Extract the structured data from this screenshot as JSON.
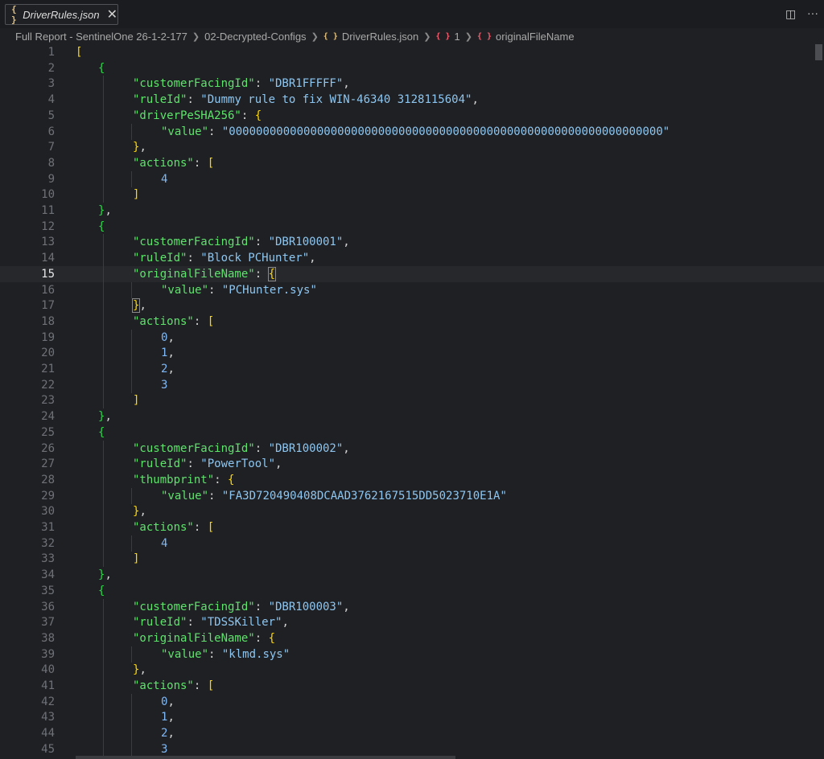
{
  "tab": {
    "icon": "{ }",
    "label": "DriverRules.json",
    "close": "✕"
  },
  "top_icons": {
    "split": "◫",
    "more": "···"
  },
  "breadcrumb": [
    {
      "label": "Full Report - SentinelOne 26-1-2-177"
    },
    {
      "label": "02-Decrypted-Configs"
    },
    {
      "icon": "{ }",
      "label": "DriverRules.json"
    },
    {
      "icon": "{ }",
      "label": "1"
    },
    {
      "icon": "{ }",
      "label": "originalFileName"
    }
  ],
  "current_line": 15,
  "lines": [
    {
      "n": "1",
      "d": 0,
      "t": [
        [
          "[",
          "b1"
        ]
      ]
    },
    {
      "n": "2",
      "d": 1,
      "t": [
        [
          "{",
          "b2"
        ]
      ]
    },
    {
      "n": "3",
      "d": 2,
      "t": [
        [
          "\"customerFacingId\"",
          "k"
        ],
        [
          ": ",
          "p"
        ],
        [
          "\"DBR1FFFFF\"",
          "s"
        ],
        [
          ",",
          "p"
        ]
      ]
    },
    {
      "n": "4",
      "d": 2,
      "t": [
        [
          "\"ruleId\"",
          "k"
        ],
        [
          ": ",
          "p"
        ],
        [
          "\"Dummy rule to fix WIN-46340 3128115604\"",
          "s"
        ],
        [
          ",",
          "p"
        ]
      ]
    },
    {
      "n": "5",
      "d": 2,
      "t": [
        [
          "\"driverPeSHA256\"",
          "k"
        ],
        [
          ": ",
          "p"
        ],
        [
          "{",
          "b1"
        ]
      ]
    },
    {
      "n": "6",
      "d": 3,
      "t": [
        [
          "\"value\"",
          "k"
        ],
        [
          ": ",
          "p"
        ],
        [
          "\"0000000000000000000000000000000000000000000000000000000000000000\"",
          "s"
        ]
      ]
    },
    {
      "n": "7",
      "d": 2,
      "t": [
        [
          "}",
          "b1"
        ],
        [
          ",",
          "p"
        ]
      ]
    },
    {
      "n": "8",
      "d": 2,
      "t": [
        [
          "\"actions\"",
          "k"
        ],
        [
          ": ",
          "p"
        ],
        [
          "[",
          "b1"
        ]
      ]
    },
    {
      "n": "9",
      "d": 3,
      "t": [
        [
          "4",
          "n"
        ]
      ]
    },
    {
      "n": "10",
      "d": 2,
      "t": [
        [
          "]",
          "b1"
        ]
      ]
    },
    {
      "n": "11",
      "d": 1,
      "t": [
        [
          "}",
          "b2"
        ],
        [
          ",",
          "p"
        ]
      ]
    },
    {
      "n": "12",
      "d": 1,
      "t": [
        [
          "{",
          "b2"
        ]
      ]
    },
    {
      "n": "13",
      "d": 2,
      "t": [
        [
          "\"customerFacingId\"",
          "k"
        ],
        [
          ": ",
          "p"
        ],
        [
          "\"DBR100001\"",
          "s"
        ],
        [
          ",",
          "p"
        ]
      ]
    },
    {
      "n": "14",
      "d": 2,
      "t": [
        [
          "\"ruleId\"",
          "k"
        ],
        [
          ": ",
          "p"
        ],
        [
          "\"Block PCHunter\"",
          "s"
        ],
        [
          ",",
          "p"
        ]
      ]
    },
    {
      "n": "15",
      "d": 2,
      "t": [
        [
          "\"originalFileName\"",
          "k"
        ],
        [
          ": ",
          "p"
        ],
        [
          "{",
          "b1h"
        ]
      ]
    },
    {
      "n": "16",
      "d": 3,
      "t": [
        [
          "\"value\"",
          "k"
        ],
        [
          ": ",
          "p"
        ],
        [
          "\"PCHunter.sys\"",
          "s"
        ]
      ]
    },
    {
      "n": "17",
      "d": 2,
      "t": [
        [
          "}",
          "b1h"
        ],
        [
          ",",
          "p"
        ]
      ]
    },
    {
      "n": "18",
      "d": 2,
      "t": [
        [
          "\"actions\"",
          "k"
        ],
        [
          ": ",
          "p"
        ],
        [
          "[",
          "b1"
        ]
      ]
    },
    {
      "n": "19",
      "d": 3,
      "t": [
        [
          "0",
          "n"
        ],
        [
          ",",
          "p"
        ]
      ]
    },
    {
      "n": "20",
      "d": 3,
      "t": [
        [
          "1",
          "n"
        ],
        [
          ",",
          "p"
        ]
      ]
    },
    {
      "n": "21",
      "d": 3,
      "t": [
        [
          "2",
          "n"
        ],
        [
          ",",
          "p"
        ]
      ]
    },
    {
      "n": "22",
      "d": 3,
      "t": [
        [
          "3",
          "n"
        ]
      ]
    },
    {
      "n": "23",
      "d": 2,
      "t": [
        [
          "]",
          "b1"
        ]
      ]
    },
    {
      "n": "24",
      "d": 1,
      "t": [
        [
          "}",
          "b2"
        ],
        [
          ",",
          "p"
        ]
      ]
    },
    {
      "n": "25",
      "d": 1,
      "t": [
        [
          "{",
          "b2"
        ]
      ]
    },
    {
      "n": "26",
      "d": 2,
      "t": [
        [
          "\"customerFacingId\"",
          "k"
        ],
        [
          ": ",
          "p"
        ],
        [
          "\"DBR100002\"",
          "s"
        ],
        [
          ",",
          "p"
        ]
      ]
    },
    {
      "n": "27",
      "d": 2,
      "t": [
        [
          "\"ruleId\"",
          "k"
        ],
        [
          ": ",
          "p"
        ],
        [
          "\"PowerTool\"",
          "s"
        ],
        [
          ",",
          "p"
        ]
      ]
    },
    {
      "n": "28",
      "d": 2,
      "t": [
        [
          "\"thumbprint\"",
          "k"
        ],
        [
          ": ",
          "p"
        ],
        [
          "{",
          "b1"
        ]
      ]
    },
    {
      "n": "29",
      "d": 3,
      "t": [
        [
          "\"value\"",
          "k"
        ],
        [
          ": ",
          "p"
        ],
        [
          "\"FA3D720490408DCAAD3762167515DD5023710E1A\"",
          "s"
        ]
      ]
    },
    {
      "n": "30",
      "d": 2,
      "t": [
        [
          "}",
          "b1"
        ],
        [
          ",",
          "p"
        ]
      ]
    },
    {
      "n": "31",
      "d": 2,
      "t": [
        [
          "\"actions\"",
          "k"
        ],
        [
          ": ",
          "p"
        ],
        [
          "[",
          "b1"
        ]
      ]
    },
    {
      "n": "32",
      "d": 3,
      "t": [
        [
          "4",
          "n"
        ]
      ]
    },
    {
      "n": "33",
      "d": 2,
      "t": [
        [
          "]",
          "b1"
        ]
      ]
    },
    {
      "n": "34",
      "d": 1,
      "t": [
        [
          "}",
          "b2"
        ],
        [
          ",",
          "p"
        ]
      ]
    },
    {
      "n": "35",
      "d": 1,
      "t": [
        [
          "{",
          "b2"
        ]
      ]
    },
    {
      "n": "36",
      "d": 2,
      "t": [
        [
          "\"customerFacingId\"",
          "k"
        ],
        [
          ": ",
          "p"
        ],
        [
          "\"DBR100003\"",
          "s"
        ],
        [
          ",",
          "p"
        ]
      ]
    },
    {
      "n": "37",
      "d": 2,
      "t": [
        [
          "\"ruleId\"",
          "k"
        ],
        [
          ": ",
          "p"
        ],
        [
          "\"TDSSKiller\"",
          "s"
        ],
        [
          ",",
          "p"
        ]
      ]
    },
    {
      "n": "38",
      "d": 2,
      "t": [
        [
          "\"originalFileName\"",
          "k"
        ],
        [
          ": ",
          "p"
        ],
        [
          "{",
          "b1"
        ]
      ]
    },
    {
      "n": "39",
      "d": 3,
      "t": [
        [
          "\"value\"",
          "k"
        ],
        [
          ": ",
          "p"
        ],
        [
          "\"klmd.sys\"",
          "s"
        ]
      ]
    },
    {
      "n": "40",
      "d": 2,
      "t": [
        [
          "}",
          "b1"
        ],
        [
          ",",
          "p"
        ]
      ]
    },
    {
      "n": "41",
      "d": 2,
      "t": [
        [
          "\"actions\"",
          "k"
        ],
        [
          ": ",
          "p"
        ],
        [
          "[",
          "b1"
        ]
      ]
    },
    {
      "n": "42",
      "d": 3,
      "t": [
        [
          "0",
          "n"
        ],
        [
          ",",
          "p"
        ]
      ]
    },
    {
      "n": "43",
      "d": 3,
      "t": [
        [
          "1",
          "n"
        ],
        [
          ",",
          "p"
        ]
      ]
    },
    {
      "n": "44",
      "d": 3,
      "t": [
        [
          "2",
          "n"
        ],
        [
          ",",
          "p"
        ]
      ]
    },
    {
      "n": "45",
      "d": 3,
      "t": [
        [
          "3",
          "n"
        ]
      ]
    }
  ]
}
